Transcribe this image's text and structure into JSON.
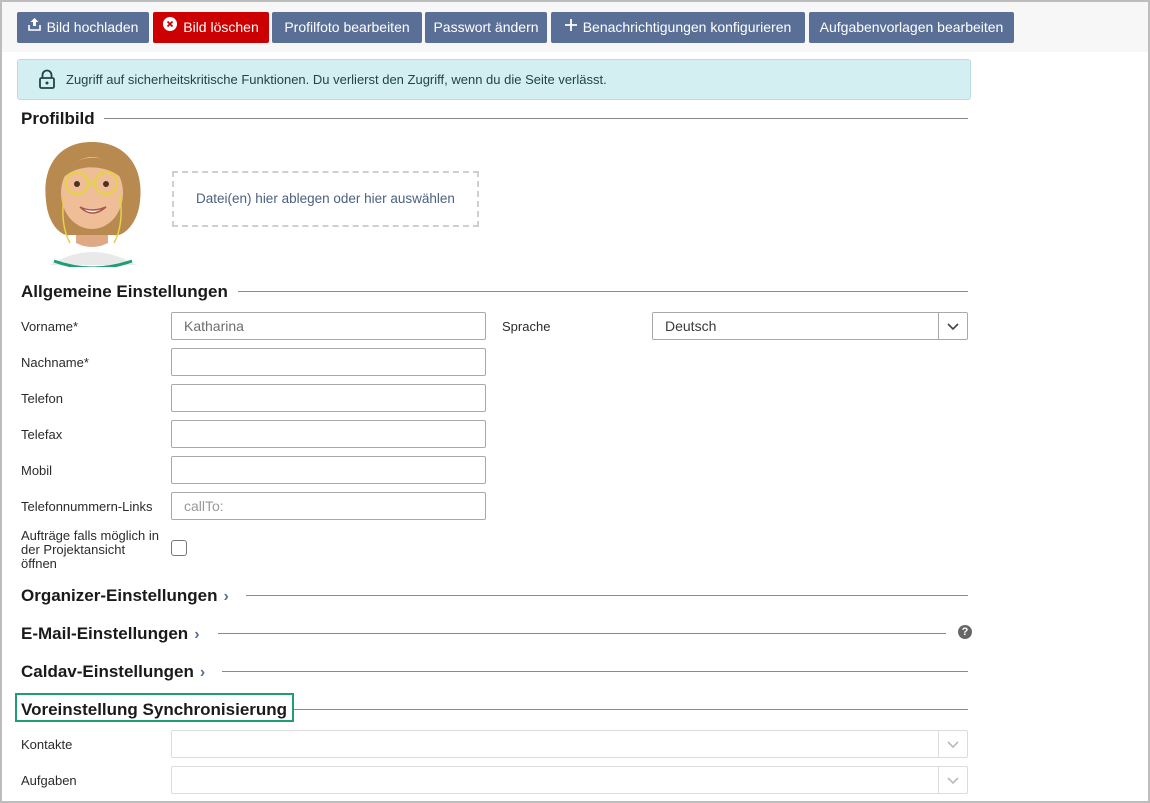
{
  "toolbar": {
    "upload_label": "Bild hochladen",
    "delete_label": "Bild löschen",
    "edit_photo_label": "Profilfoto bearbeiten",
    "change_password_label": "Passwort ändern",
    "notifications_label": "Benachrichtigungen konfigurieren",
    "task_templates_label": "Aufgabenvorlagen bearbeiten"
  },
  "alert": {
    "text": "Zugriff auf sicherheitskritische Funktionen. Du verlierst den Zugriff, wenn du die Seite verlässt."
  },
  "profile": {
    "title": "Profilbild",
    "dropzone_text": "Datei(en) hier ablegen oder hier auswählen"
  },
  "general": {
    "title": "Allgemeine Einstellungen",
    "firstname_label": "Vorname*",
    "firstname_value": "Katharina",
    "lastname_label": "Nachname*",
    "phone_label": "Telefon",
    "fax_label": "Telefax",
    "mobile_label": "Mobil",
    "phone_links_label": "Telefonnummern-Links",
    "phone_links_placeholder": "callTo:",
    "project_view_label_1": "Aufträge falls möglich in",
    "project_view_label_2": "der Projektansicht",
    "project_view_label_3": "öffnen",
    "language_label": "Sprache",
    "language_value": "Deutsch"
  },
  "sections": {
    "organizer": "Organizer-Einstellungen",
    "email": "E-Mail-Einstellungen",
    "caldav": "Caldav-Einstellungen",
    "sync": "Voreinstellung Synchronisierung"
  },
  "sync": {
    "contacts_label": "Kontakte",
    "tasks_label": "Aufgaben"
  },
  "icons": {
    "help": "?",
    "chevron": "›",
    "dropdown": "⌄"
  },
  "colors": {
    "button": "#5a6f96",
    "danger": "#cc0000",
    "alert_bg": "#d4eff2",
    "highlight": "#1f9e74"
  }
}
